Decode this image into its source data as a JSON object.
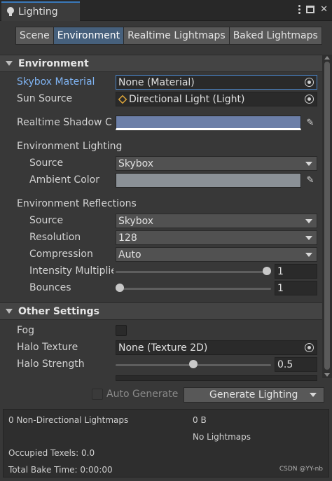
{
  "window": {
    "title": "Lighting",
    "menu_icon": "kebab-menu-icon",
    "maximize_icon": "maximize-icon",
    "close_glyph": "✕"
  },
  "tabs": [
    {
      "label": "Scene",
      "active": false
    },
    {
      "label": "Environment",
      "active": true
    },
    {
      "label": "Realtime Lightmaps",
      "active": false
    },
    {
      "label": "Baked Lightmaps",
      "active": false
    }
  ],
  "environment": {
    "header": "Environment",
    "skybox_material": {
      "label": "Skybox Material",
      "value": "None (Material)"
    },
    "sun_source": {
      "label": "Sun Source",
      "value": "Directional Light (Light)"
    },
    "realtime_shadow": {
      "label": "Realtime Shadow C",
      "color": "#6c7fa8"
    },
    "env_lighting": {
      "header": "Environment Lighting",
      "source": {
        "label": "Source",
        "value": "Skybox"
      },
      "ambient_color": {
        "label": "Ambient Color",
        "color": "#8a9096"
      }
    },
    "env_reflections": {
      "header": "Environment Reflections",
      "source": {
        "label": "Source",
        "value": "Skybox"
      },
      "resolution": {
        "label": "Resolution",
        "value": "128"
      },
      "compression": {
        "label": "Compression",
        "value": "Auto"
      },
      "intensity": {
        "label": "Intensity Multiplie",
        "value": "1",
        "fraction": 1.0
      },
      "bounces": {
        "label": "Bounces",
        "value": "1",
        "fraction": 0.0
      }
    }
  },
  "other_settings": {
    "header": "Other Settings",
    "fog": {
      "label": "Fog",
      "checked": false
    },
    "halo_texture": {
      "label": "Halo Texture",
      "value": "None (Texture 2D)"
    },
    "halo_strength": {
      "label": "Halo Strength",
      "value": "0.5",
      "fraction": 0.5
    }
  },
  "generate": {
    "auto_label": "Auto Generate",
    "button_label": "Generate Lighting"
  },
  "stats": {
    "non_directional": "0 Non-Directional Lightmaps",
    "size": "0 B",
    "no_lightmaps": "No Lightmaps",
    "occupied_texels": "Occupied Texels: 0.0",
    "total_bake_time": "Total Bake Time: 0:00:00"
  },
  "watermark": "CSDN @YY-nb",
  "colors": {
    "accent": "#3a79bb",
    "active_tab": "#46607c",
    "link_label": "#7fb3f2"
  }
}
